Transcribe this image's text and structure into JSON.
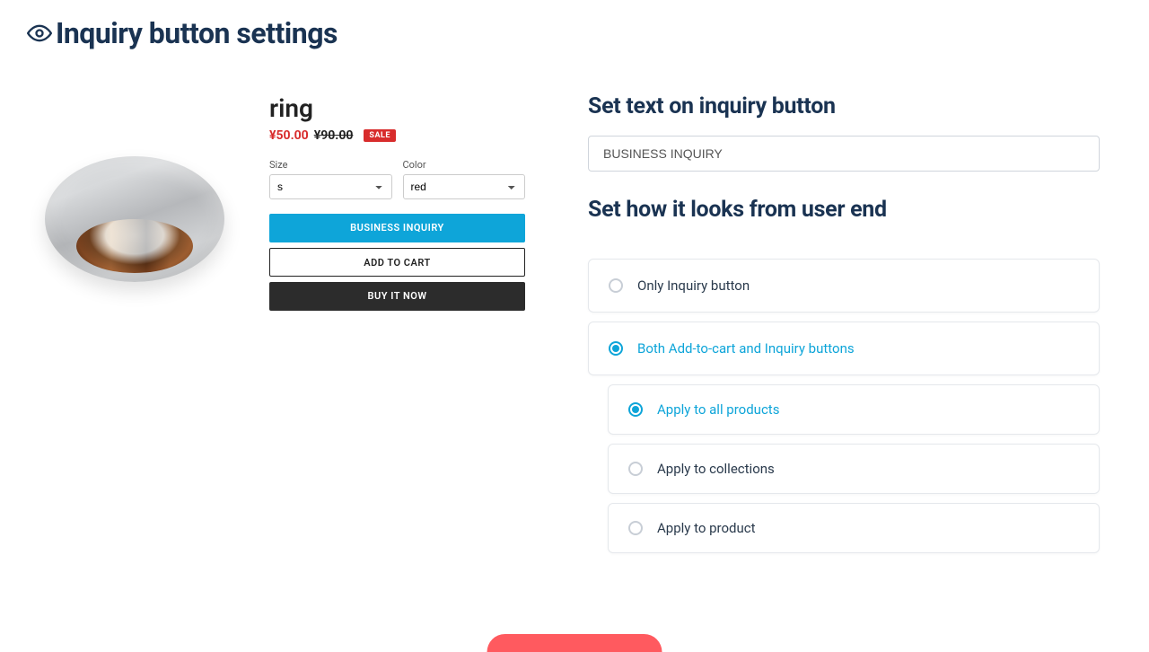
{
  "header": {
    "title": "Inquiry button settings"
  },
  "preview": {
    "product_name": "ring",
    "price_sale": "¥50.00",
    "price_original": "¥90.00",
    "sale_badge": "SALE",
    "size_label": "Size",
    "size_value": "s",
    "color_label": "Color",
    "color_value": "red",
    "inquiry_button": "BUSINESS INQUIRY",
    "add_to_cart": "ADD TO CART",
    "buy_now": "BUY IT NOW"
  },
  "settings": {
    "text_section_title": "Set text on inquiry button",
    "text_input_value": "BUSINESS INQUIRY",
    "look_section_title": "Set how it looks from user end",
    "option_only_inquiry": "Only Inquiry button",
    "option_both": "Both Add-to-cart and Inquiry buttons",
    "sub_all_products": "Apply to all products",
    "sub_collections": "Apply to collections",
    "sub_product": "Apply to product"
  }
}
